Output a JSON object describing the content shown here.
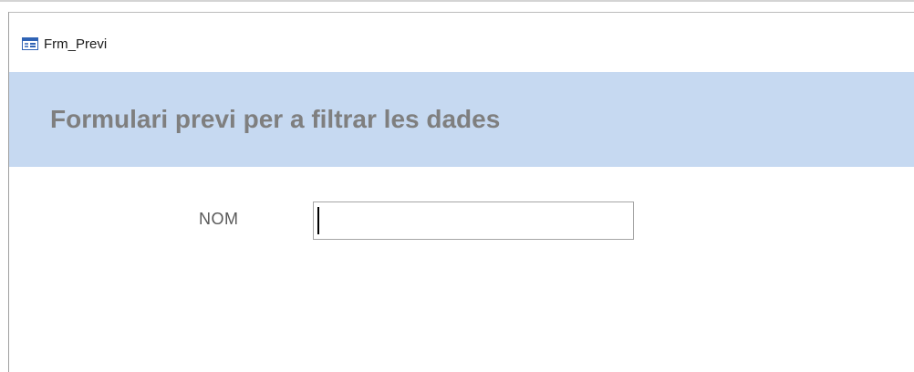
{
  "tab": {
    "icon": "form-icon",
    "label": "Frm_Previ"
  },
  "header": {
    "title": "Formulari previ per a filtrar les dades",
    "background_color": "#c6d9f1",
    "title_color": "#7f7f7f"
  },
  "form": {
    "fields": [
      {
        "label": "NOM",
        "value": "",
        "placeholder": ""
      }
    ]
  }
}
